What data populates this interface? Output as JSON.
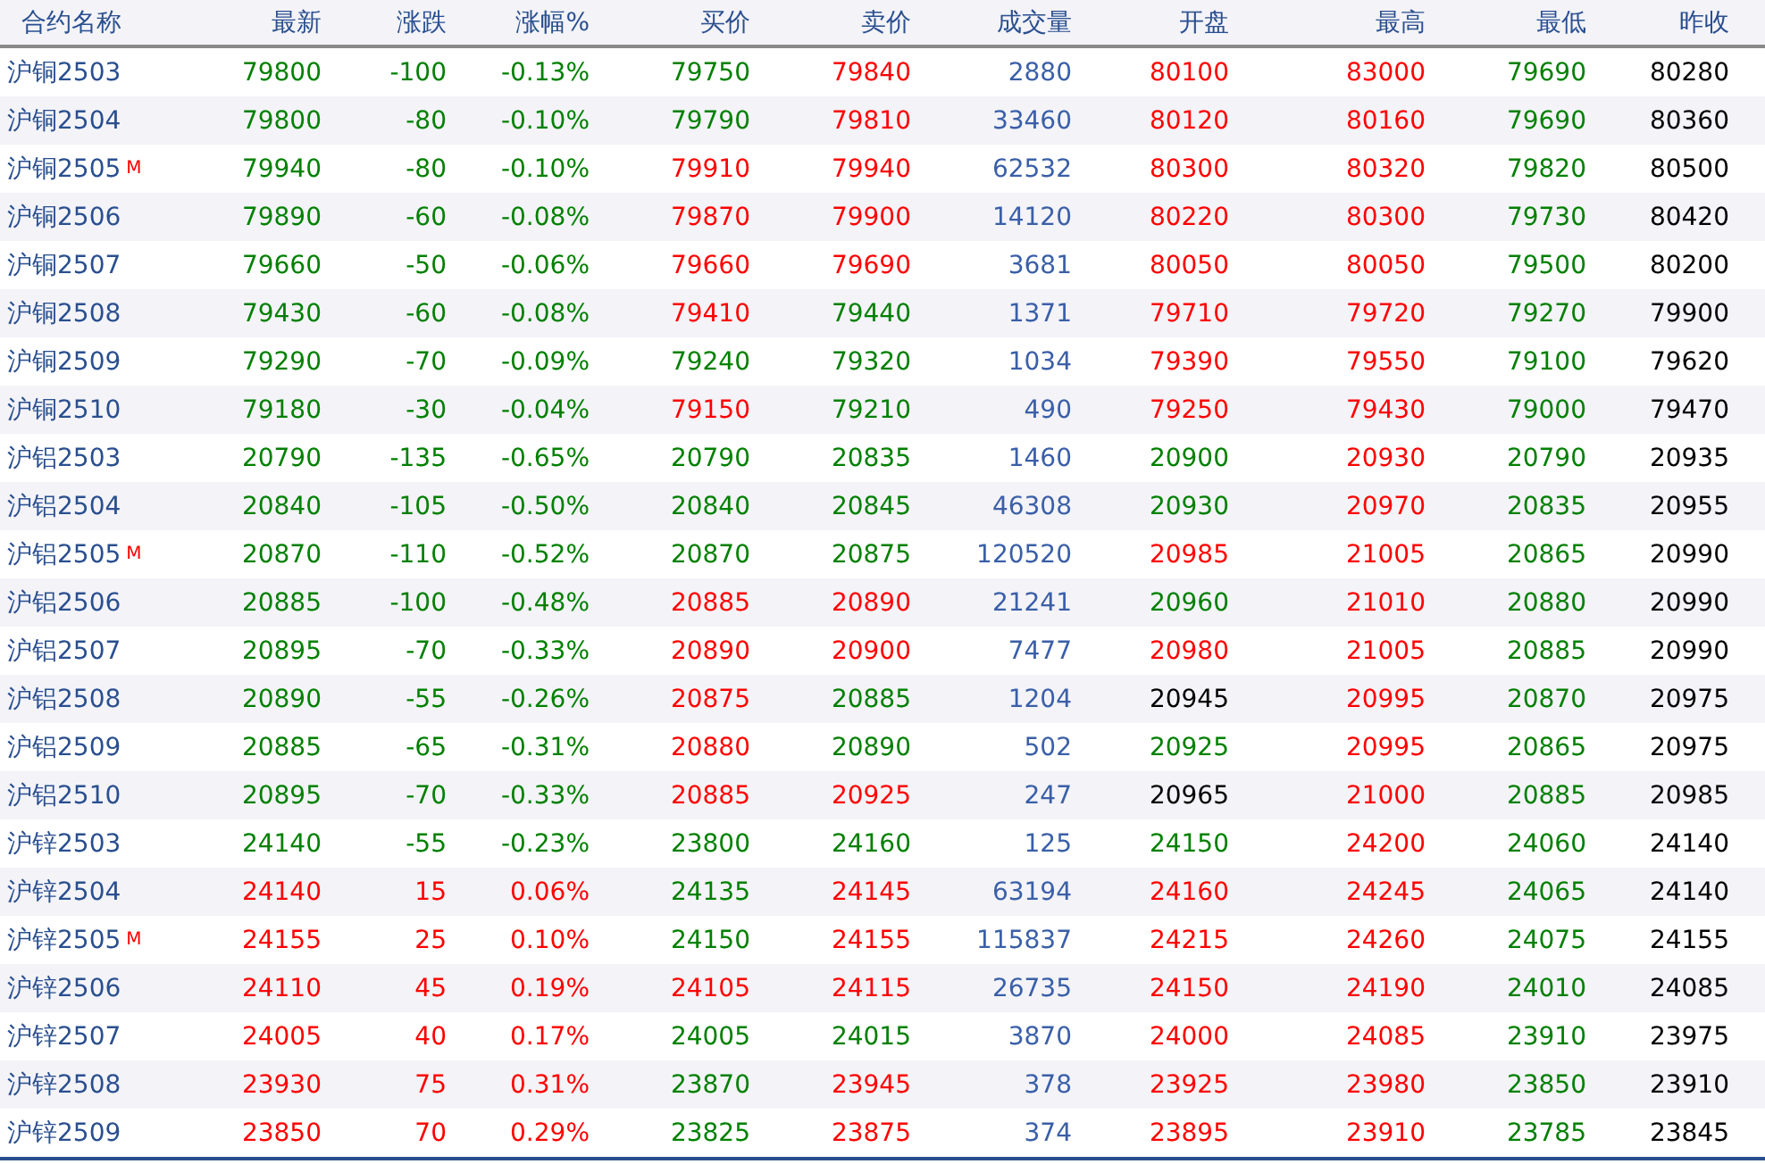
{
  "table": {
    "columns": [
      "合约名称",
      "最新",
      "涨跌",
      "涨幅%",
      "买价",
      "卖价",
      "成交量",
      "开盘",
      "最高",
      "最低",
      "昨收"
    ],
    "rows": [
      {
        "cells": [
          {
            "text": "沪铜2503"
          },
          {
            "text": "79800",
            "color": "#008000"
          },
          {
            "text": "-100",
            "color": "#008000"
          },
          {
            "text": "-0.13%",
            "color": "#008000"
          },
          {
            "text": "79750",
            "color": "#008000"
          },
          {
            "text": "79840",
            "color": "#ff0000"
          },
          {
            "text": "2880",
            "color": "#3a5fa8"
          },
          {
            "text": "80100",
            "color": "#ff0000"
          },
          {
            "text": "83000",
            "color": "#ff0000"
          },
          {
            "text": "79690",
            "color": "#008000"
          },
          {
            "text": "80280",
            "color": "#000000"
          }
        ]
      },
      {
        "cells": [
          {
            "text": "沪铜2504"
          },
          {
            "text": "79800",
            "color": "#008000"
          },
          {
            "text": "-80",
            "color": "#008000"
          },
          {
            "text": "-0.10%",
            "color": "#008000"
          },
          {
            "text": "79790",
            "color": "#008000"
          },
          {
            "text": "79810",
            "color": "#ff0000"
          },
          {
            "text": "33460",
            "color": "#3a5fa8"
          },
          {
            "text": "80120",
            "color": "#ff0000"
          },
          {
            "text": "80160",
            "color": "#ff0000"
          },
          {
            "text": "79690",
            "color": "#008000"
          },
          {
            "text": "80360",
            "color": "#000000"
          }
        ]
      },
      {
        "badge": "M",
        "cells": [
          {
            "text": "沪铜2505"
          },
          {
            "text": "79940",
            "color": "#008000"
          },
          {
            "text": "-80",
            "color": "#008000"
          },
          {
            "text": "-0.10%",
            "color": "#008000"
          },
          {
            "text": "79910",
            "color": "#ff0000"
          },
          {
            "text": "79940",
            "color": "#ff0000"
          },
          {
            "text": "62532",
            "color": "#3a5fa8"
          },
          {
            "text": "80300",
            "color": "#ff0000"
          },
          {
            "text": "80320",
            "color": "#ff0000"
          },
          {
            "text": "79820",
            "color": "#008000"
          },
          {
            "text": "80500",
            "color": "#000000"
          }
        ]
      },
      {
        "cells": [
          {
            "text": "沪铜2506"
          },
          {
            "text": "79890",
            "color": "#008000"
          },
          {
            "text": "-60",
            "color": "#008000"
          },
          {
            "text": "-0.08%",
            "color": "#008000"
          },
          {
            "text": "79870",
            "color": "#ff0000"
          },
          {
            "text": "79900",
            "color": "#ff0000"
          },
          {
            "text": "14120",
            "color": "#3a5fa8"
          },
          {
            "text": "80220",
            "color": "#ff0000"
          },
          {
            "text": "80300",
            "color": "#ff0000"
          },
          {
            "text": "79730",
            "color": "#008000"
          },
          {
            "text": "80420",
            "color": "#000000"
          }
        ]
      },
      {
        "cells": [
          {
            "text": "沪铜2507"
          },
          {
            "text": "79660",
            "color": "#008000"
          },
          {
            "text": "-50",
            "color": "#008000"
          },
          {
            "text": "-0.06%",
            "color": "#008000"
          },
          {
            "text": "79660",
            "color": "#ff0000"
          },
          {
            "text": "79690",
            "color": "#ff0000"
          },
          {
            "text": "3681",
            "color": "#3a5fa8"
          },
          {
            "text": "80050",
            "color": "#ff0000"
          },
          {
            "text": "80050",
            "color": "#ff0000"
          },
          {
            "text": "79500",
            "color": "#008000"
          },
          {
            "text": "80200",
            "color": "#000000"
          }
        ]
      },
      {
        "cells": [
          {
            "text": "沪铜2508"
          },
          {
            "text": "79430",
            "color": "#008000"
          },
          {
            "text": "-60",
            "color": "#008000"
          },
          {
            "text": "-0.08%",
            "color": "#008000"
          },
          {
            "text": "79410",
            "color": "#ff0000"
          },
          {
            "text": "79440",
            "color": "#008000"
          },
          {
            "text": "1371",
            "color": "#3a5fa8"
          },
          {
            "text": "79710",
            "color": "#ff0000"
          },
          {
            "text": "79720",
            "color": "#ff0000"
          },
          {
            "text": "79270",
            "color": "#008000"
          },
          {
            "text": "79900",
            "color": "#000000"
          }
        ]
      },
      {
        "cells": [
          {
            "text": "沪铜2509"
          },
          {
            "text": "79290",
            "color": "#008000"
          },
          {
            "text": "-70",
            "color": "#008000"
          },
          {
            "text": "-0.09%",
            "color": "#008000"
          },
          {
            "text": "79240",
            "color": "#008000"
          },
          {
            "text": "79320",
            "color": "#008000"
          },
          {
            "text": "1034",
            "color": "#3a5fa8"
          },
          {
            "text": "79390",
            "color": "#ff0000"
          },
          {
            "text": "79550",
            "color": "#ff0000"
          },
          {
            "text": "79100",
            "color": "#008000"
          },
          {
            "text": "79620",
            "color": "#000000"
          }
        ]
      },
      {
        "cells": [
          {
            "text": "沪铜2510"
          },
          {
            "text": "79180",
            "color": "#008000"
          },
          {
            "text": "-30",
            "color": "#008000"
          },
          {
            "text": "-0.04%",
            "color": "#008000"
          },
          {
            "text": "79150",
            "color": "#ff0000"
          },
          {
            "text": "79210",
            "color": "#008000"
          },
          {
            "text": "490",
            "color": "#3a5fa8"
          },
          {
            "text": "79250",
            "color": "#ff0000"
          },
          {
            "text": "79430",
            "color": "#ff0000"
          },
          {
            "text": "79000",
            "color": "#008000"
          },
          {
            "text": "79470",
            "color": "#000000"
          }
        ]
      },
      {
        "cells": [
          {
            "text": "沪铝2503"
          },
          {
            "text": "20790",
            "color": "#008000"
          },
          {
            "text": "-135",
            "color": "#008000"
          },
          {
            "text": "-0.65%",
            "color": "#008000"
          },
          {
            "text": "20790",
            "color": "#008000"
          },
          {
            "text": "20835",
            "color": "#008000"
          },
          {
            "text": "1460",
            "color": "#3a5fa8"
          },
          {
            "text": "20900",
            "color": "#008000"
          },
          {
            "text": "20930",
            "color": "#ff0000"
          },
          {
            "text": "20790",
            "color": "#008000"
          },
          {
            "text": "20935",
            "color": "#000000"
          }
        ]
      },
      {
        "cells": [
          {
            "text": "沪铝2504"
          },
          {
            "text": "20840",
            "color": "#008000"
          },
          {
            "text": "-105",
            "color": "#008000"
          },
          {
            "text": "-0.50%",
            "color": "#008000"
          },
          {
            "text": "20840",
            "color": "#008000"
          },
          {
            "text": "20845",
            "color": "#008000"
          },
          {
            "text": "46308",
            "color": "#3a5fa8"
          },
          {
            "text": "20930",
            "color": "#008000"
          },
          {
            "text": "20970",
            "color": "#ff0000"
          },
          {
            "text": "20835",
            "color": "#008000"
          },
          {
            "text": "20955",
            "color": "#000000"
          }
        ]
      },
      {
        "badge": "M",
        "cells": [
          {
            "text": "沪铝2505"
          },
          {
            "text": "20870",
            "color": "#008000"
          },
          {
            "text": "-110",
            "color": "#008000"
          },
          {
            "text": "-0.52%",
            "color": "#008000"
          },
          {
            "text": "20870",
            "color": "#008000"
          },
          {
            "text": "20875",
            "color": "#008000"
          },
          {
            "text": "120520",
            "color": "#3a5fa8"
          },
          {
            "text": "20985",
            "color": "#ff0000"
          },
          {
            "text": "21005",
            "color": "#ff0000"
          },
          {
            "text": "20865",
            "color": "#008000"
          },
          {
            "text": "20990",
            "color": "#000000"
          }
        ]
      },
      {
        "cells": [
          {
            "text": "沪铝2506"
          },
          {
            "text": "20885",
            "color": "#008000"
          },
          {
            "text": "-100",
            "color": "#008000"
          },
          {
            "text": "-0.48%",
            "color": "#008000"
          },
          {
            "text": "20885",
            "color": "#ff0000"
          },
          {
            "text": "20890",
            "color": "#ff0000"
          },
          {
            "text": "21241",
            "color": "#3a5fa8"
          },
          {
            "text": "20960",
            "color": "#008000"
          },
          {
            "text": "21010",
            "color": "#ff0000"
          },
          {
            "text": "20880",
            "color": "#008000"
          },
          {
            "text": "20990",
            "color": "#000000"
          }
        ]
      },
      {
        "cells": [
          {
            "text": "沪铝2507"
          },
          {
            "text": "20895",
            "color": "#008000"
          },
          {
            "text": "-70",
            "color": "#008000"
          },
          {
            "text": "-0.33%",
            "color": "#008000"
          },
          {
            "text": "20890",
            "color": "#ff0000"
          },
          {
            "text": "20900",
            "color": "#ff0000"
          },
          {
            "text": "7477",
            "color": "#3a5fa8"
          },
          {
            "text": "20980",
            "color": "#ff0000"
          },
          {
            "text": "21005",
            "color": "#ff0000"
          },
          {
            "text": "20885",
            "color": "#008000"
          },
          {
            "text": "20990",
            "color": "#000000"
          }
        ]
      },
      {
        "cells": [
          {
            "text": "沪铝2508"
          },
          {
            "text": "20890",
            "color": "#008000"
          },
          {
            "text": "-55",
            "color": "#008000"
          },
          {
            "text": "-0.26%",
            "color": "#008000"
          },
          {
            "text": "20875",
            "color": "#ff0000"
          },
          {
            "text": "20885",
            "color": "#008000"
          },
          {
            "text": "1204",
            "color": "#3a5fa8"
          },
          {
            "text": "20945",
            "color": "#000000"
          },
          {
            "text": "20995",
            "color": "#ff0000"
          },
          {
            "text": "20870",
            "color": "#008000"
          },
          {
            "text": "20975",
            "color": "#000000"
          }
        ]
      },
      {
        "cells": [
          {
            "text": "沪铝2509"
          },
          {
            "text": "20885",
            "color": "#008000"
          },
          {
            "text": "-65",
            "color": "#008000"
          },
          {
            "text": "-0.31%",
            "color": "#008000"
          },
          {
            "text": "20880",
            "color": "#ff0000"
          },
          {
            "text": "20890",
            "color": "#008000"
          },
          {
            "text": "502",
            "color": "#3a5fa8"
          },
          {
            "text": "20925",
            "color": "#008000"
          },
          {
            "text": "20995",
            "color": "#ff0000"
          },
          {
            "text": "20865",
            "color": "#008000"
          },
          {
            "text": "20975",
            "color": "#000000"
          }
        ]
      },
      {
        "cells": [
          {
            "text": "沪铝2510"
          },
          {
            "text": "20895",
            "color": "#008000"
          },
          {
            "text": "-70",
            "color": "#008000"
          },
          {
            "text": "-0.33%",
            "color": "#008000"
          },
          {
            "text": "20885",
            "color": "#ff0000"
          },
          {
            "text": "20925",
            "color": "#ff0000"
          },
          {
            "text": "247",
            "color": "#3a5fa8"
          },
          {
            "text": "20965",
            "color": "#000000"
          },
          {
            "text": "21000",
            "color": "#ff0000"
          },
          {
            "text": "20885",
            "color": "#008000"
          },
          {
            "text": "20985",
            "color": "#000000"
          }
        ]
      },
      {
        "cells": [
          {
            "text": "沪锌2503"
          },
          {
            "text": "24140",
            "color": "#008000"
          },
          {
            "text": "-55",
            "color": "#008000"
          },
          {
            "text": "-0.23%",
            "color": "#008000"
          },
          {
            "text": "23800",
            "color": "#008000"
          },
          {
            "text": "24160",
            "color": "#008000"
          },
          {
            "text": "125",
            "color": "#3a5fa8"
          },
          {
            "text": "24150",
            "color": "#008000"
          },
          {
            "text": "24200",
            "color": "#ff0000"
          },
          {
            "text": "24060",
            "color": "#008000"
          },
          {
            "text": "24140",
            "color": "#000000"
          }
        ]
      },
      {
        "cells": [
          {
            "text": "沪锌2504"
          },
          {
            "text": "24140",
            "color": "#ff0000"
          },
          {
            "text": "15",
            "color": "#ff0000"
          },
          {
            "text": "0.06%",
            "color": "#ff0000"
          },
          {
            "text": "24135",
            "color": "#008000"
          },
          {
            "text": "24145",
            "color": "#ff0000"
          },
          {
            "text": "63194",
            "color": "#3a5fa8"
          },
          {
            "text": "24160",
            "color": "#ff0000"
          },
          {
            "text": "24245",
            "color": "#ff0000"
          },
          {
            "text": "24065",
            "color": "#008000"
          },
          {
            "text": "24140",
            "color": "#000000"
          }
        ]
      },
      {
        "badge": "M",
        "cells": [
          {
            "text": "沪锌2505"
          },
          {
            "text": "24155",
            "color": "#ff0000"
          },
          {
            "text": "25",
            "color": "#ff0000"
          },
          {
            "text": "0.10%",
            "color": "#ff0000"
          },
          {
            "text": "24150",
            "color": "#008000"
          },
          {
            "text": "24155",
            "color": "#ff0000"
          },
          {
            "text": "115837",
            "color": "#3a5fa8"
          },
          {
            "text": "24215",
            "color": "#ff0000"
          },
          {
            "text": "24260",
            "color": "#ff0000"
          },
          {
            "text": "24075",
            "color": "#008000"
          },
          {
            "text": "24155",
            "color": "#000000"
          }
        ]
      },
      {
        "cells": [
          {
            "text": "沪锌2506"
          },
          {
            "text": "24110",
            "color": "#ff0000"
          },
          {
            "text": "45",
            "color": "#ff0000"
          },
          {
            "text": "0.19%",
            "color": "#ff0000"
          },
          {
            "text": "24105",
            "color": "#ff0000"
          },
          {
            "text": "24115",
            "color": "#ff0000"
          },
          {
            "text": "26735",
            "color": "#3a5fa8"
          },
          {
            "text": "24150",
            "color": "#ff0000"
          },
          {
            "text": "24190",
            "color": "#ff0000"
          },
          {
            "text": "24010",
            "color": "#008000"
          },
          {
            "text": "24085",
            "color": "#000000"
          }
        ]
      },
      {
        "cells": [
          {
            "text": "沪锌2507"
          },
          {
            "text": "24005",
            "color": "#ff0000"
          },
          {
            "text": "40",
            "color": "#ff0000"
          },
          {
            "text": "0.17%",
            "color": "#ff0000"
          },
          {
            "text": "24005",
            "color": "#008000"
          },
          {
            "text": "24015",
            "color": "#008000"
          },
          {
            "text": "3870",
            "color": "#3a5fa8"
          },
          {
            "text": "24000",
            "color": "#ff0000"
          },
          {
            "text": "24085",
            "color": "#ff0000"
          },
          {
            "text": "23910",
            "color": "#008000"
          },
          {
            "text": "23975",
            "color": "#000000"
          }
        ]
      },
      {
        "cells": [
          {
            "text": "沪锌2508"
          },
          {
            "text": "23930",
            "color": "#ff0000"
          },
          {
            "text": "75",
            "color": "#ff0000"
          },
          {
            "text": "0.31%",
            "color": "#ff0000"
          },
          {
            "text": "23870",
            "color": "#008000"
          },
          {
            "text": "23945",
            "color": "#ff0000"
          },
          {
            "text": "378",
            "color": "#3a5fa8"
          },
          {
            "text": "23925",
            "color": "#ff0000"
          },
          {
            "text": "23980",
            "color": "#ff0000"
          },
          {
            "text": "23850",
            "color": "#008000"
          },
          {
            "text": "23910",
            "color": "#000000"
          }
        ]
      },
      {
        "cells": [
          {
            "text": "沪锌2509"
          },
          {
            "text": "23850",
            "color": "#ff0000"
          },
          {
            "text": "70",
            "color": "#ff0000"
          },
          {
            "text": "0.29%",
            "color": "#ff0000"
          },
          {
            "text": "23825",
            "color": "#008000"
          },
          {
            "text": "23875",
            "color": "#ff0000"
          },
          {
            "text": "374",
            "color": "#3a5fa8"
          },
          {
            "text": "23895",
            "color": "#ff0000"
          },
          {
            "text": "23910",
            "color": "#ff0000"
          },
          {
            "text": "23785",
            "color": "#008000"
          },
          {
            "text": "23845",
            "color": "#000000"
          }
        ]
      }
    ]
  }
}
